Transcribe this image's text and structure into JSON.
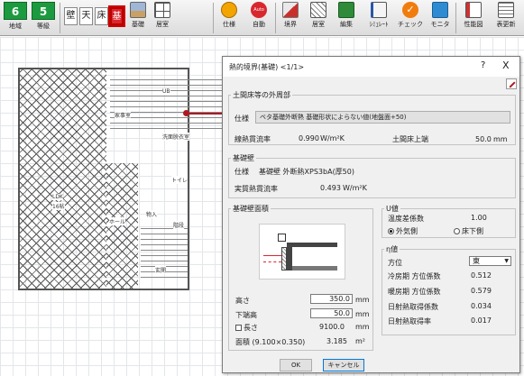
{
  "toolbar": {
    "region_num": "6",
    "region_label": "地域",
    "grade_num": "5",
    "grade_label": "等級",
    "toggles": [
      "壁",
      "天",
      "床",
      "基"
    ],
    "foundation_label": "基礎",
    "room_label": "居室",
    "spec_label": "仕様",
    "auto_badge": "Auto",
    "auto_label": "自動",
    "boundary_label": "境界",
    "room2_label": "居室",
    "edit_label": "編集",
    "sim_label": "ｼﾐｭﾚｰﾄ",
    "check_label": "チェック",
    "monitor_label": "モニタ",
    "perf_label": "性能図",
    "table_label": "表更新"
  },
  "floorplan": {
    "rooms": [
      "家事室",
      "UB",
      "洗面脱衣室",
      "トイレ",
      "LDK",
      "ホール",
      "物入",
      "階段",
      "玄関"
    ],
    "ldk_area": "16帖"
  },
  "dialog": {
    "title": "熱的境界(基礎) <1/1>",
    "help": "?",
    "close": "X",
    "perimeter": {
      "group_label": "土間床等の外周部",
      "spec_label": "仕様",
      "spec_value": "ベタ基礎外断熱 基礎形状によらない値(地盤面+50)",
      "linear_label": "線熱貫流率",
      "linear_value": "0.990",
      "linear_unit": "W/m²K",
      "top_label": "土間床上端",
      "top_value": "50.0",
      "top_unit": "mm"
    },
    "foundation_wall": {
      "group_label": "基礎壁",
      "spec_label": "仕様",
      "spec_value": "基礎壁 外断熱XPS3bA(厚50)",
      "actual_label": "実質熱貫流率",
      "actual_value": "0.493",
      "actual_unit": "W/m²K"
    },
    "area": {
      "group_label": "基礎壁面積",
      "height_label": "高さ",
      "height_value": "350.0",
      "height_unit": "mm",
      "bottom_label": "下端高",
      "bottom_value": "50.0",
      "bottom_unit": "mm",
      "length_label": "長さ",
      "length_value": "9100.0",
      "length_unit": "mm",
      "area_label": "面積 (9.100×0.350)",
      "area_value": "3.185",
      "area_unit": "m²"
    },
    "u_value": {
      "group_label": "U値",
      "temp_label": "温度差係数",
      "temp_value": "1.00",
      "radio_outside": "外気側",
      "radio_underfloor": "床下側"
    },
    "eta": {
      "group_label": "η値",
      "direction_label": "方位",
      "direction_value": "東",
      "cool_coef_label": "冷房期 方位係数",
      "cool_coef_value": "0.512",
      "heat_coef_label": "暖房期 方位係数",
      "heat_coef_value": "0.579",
      "solar_gain_label": "日射熱取得係数",
      "solar_gain_value": "0.034",
      "solar_rate_label": "日射熱取得率",
      "solar_rate_value": "0.017"
    },
    "ok": "OK",
    "cancel": "キャンセル"
  },
  "colors": {
    "accent_green": "#1d9a3f",
    "active_red": "#d9272e",
    "marker_red": "#b01820"
  }
}
